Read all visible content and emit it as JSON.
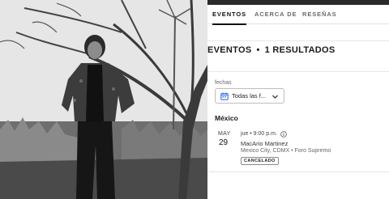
{
  "tabs": [
    {
      "label": "EVENTOS",
      "active": true
    },
    {
      "label": "ACERCA DE",
      "active": false
    },
    {
      "label": "RESEÑAS",
      "active": false
    }
  ],
  "results": {
    "title": "EVENTOS",
    "separator": "•",
    "count_label": "1 RESULTADOS"
  },
  "filter": {
    "label": "fechas",
    "value": "Todas las f...",
    "icon": "calendar-icon"
  },
  "country": "México",
  "event": {
    "month": "MAY",
    "day": "29",
    "time": "jue • 9:00 p.m.",
    "name": "MacArio Martinez",
    "venue": "Mexico City, CDMX • Foro Supremo",
    "status": "CANCELADO"
  },
  "colors": {
    "topbar": "#2a2a2a",
    "accent": "#2563eb",
    "text": "#1a1a1a",
    "muted": "#6a6a6a"
  }
}
